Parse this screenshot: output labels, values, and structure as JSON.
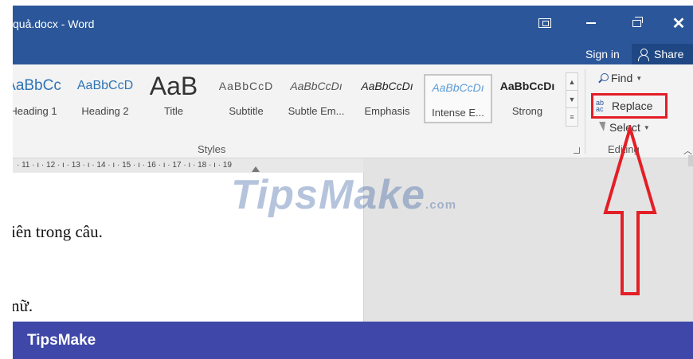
{
  "window": {
    "doc_title": "quả.docx - Word",
    "close_glyph": "✕"
  },
  "account": {
    "signin": "Sign in",
    "share": "Share"
  },
  "styles": {
    "items": [
      {
        "sample": "AaBbCc",
        "name": "Heading 1"
      },
      {
        "sample": "AaBbCcD",
        "name": "Heading 2"
      },
      {
        "sample": "AaB",
        "name": "Title"
      },
      {
        "sample": "AaBbCcD",
        "name": "Subtitle"
      },
      {
        "sample": "AaBbCcDı",
        "name": "Subtle Em..."
      },
      {
        "sample": "AaBbCcDı",
        "name": "Emphasis"
      },
      {
        "sample": "AaBbCcDı",
        "name": "Intense E..."
      },
      {
        "sample": "AaBbCcDı",
        "name": "Strong"
      }
    ],
    "group_label": "Styles"
  },
  "editing": {
    "find": "Find",
    "replace": "Replace",
    "select": "Select",
    "group_label": "Editing",
    "replace_icon_glyph": "ab\n↳ac",
    "highlight_color": "#e41e26"
  },
  "ruler": {
    "text": "· 11 · ı · 12 · ı · 13 · ı · 14 · ı · 15 · ı · 16 · ı · 17 · ı · 18 · ı · 19"
  },
  "document": {
    "line1": "iên trong câu.",
    "line2": "nữ."
  },
  "watermark": {
    "text": "TipsMake",
    "suffix": ".com"
  },
  "annotation": {
    "arrow_color": "#e41e26",
    "shape": "upward-arrow"
  },
  "footer": {
    "brand": "TipsMake"
  },
  "colors": {
    "title_bar": "#2b579a",
    "footer": "#3f48a8"
  }
}
